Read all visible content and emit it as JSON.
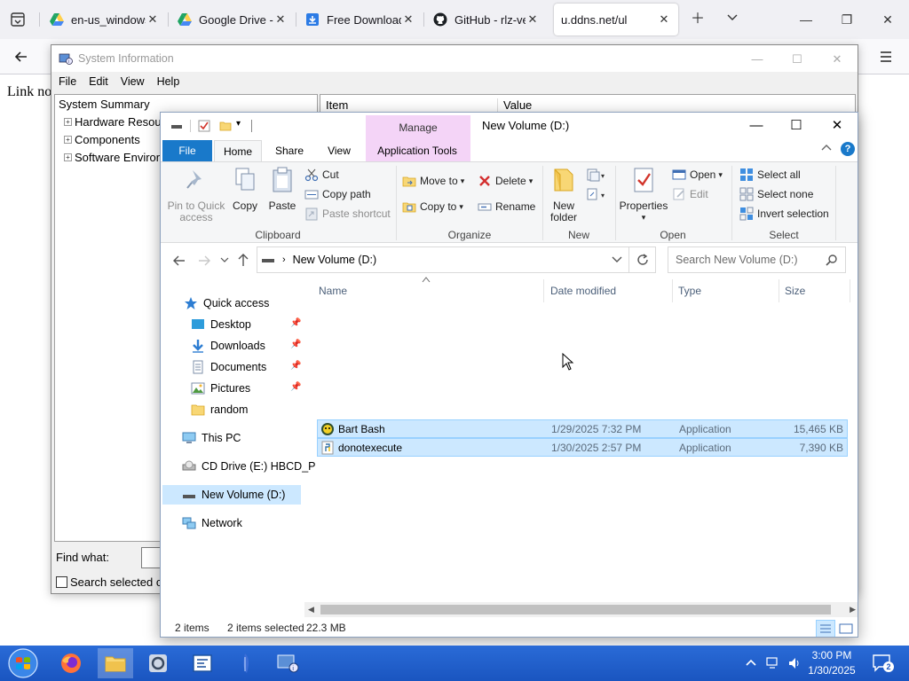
{
  "browser": {
    "tabs": [
      {
        "title": "en-us_windows",
        "icon": "google-drive-icon"
      },
      {
        "title": "Google Drive - V",
        "icon": "google-drive-icon"
      },
      {
        "title": "Free Download M",
        "icon": "download-icon"
      },
      {
        "title": "GitHub - rlz-ve/x",
        "icon": "github-icon"
      },
      {
        "title": "u.ddns.net/ul",
        "icon": ""
      }
    ],
    "page_text": "Link no"
  },
  "sysinfo": {
    "title": "System Information",
    "menu": [
      "File",
      "Edit",
      "View",
      "Help"
    ],
    "tree": [
      "System Summary",
      "Hardware Resou",
      "Components",
      "Software Enviror"
    ],
    "columns": [
      "Item",
      "Value"
    ],
    "find_label": "Find what:",
    "search_selected": "Search selected c"
  },
  "explorer": {
    "title": "New Volume (D:)",
    "manage_label": "Manage",
    "ribbon_tabs": [
      "File",
      "Home",
      "Share",
      "View",
      "Application Tools"
    ],
    "clipboard": {
      "label": "Clipboard",
      "pin": "Pin to Quick access",
      "copy": "Copy",
      "paste": "Paste",
      "cut": "Cut",
      "copy_path": "Copy path",
      "paste_shortcut": "Paste shortcut"
    },
    "organize": {
      "label": "Organize",
      "move_to": "Move to",
      "copy_to": "Copy to",
      "delete": "Delete",
      "rename": "Rename"
    },
    "new": {
      "label": "New",
      "new_folder": "New folder"
    },
    "open": {
      "label": "Open",
      "properties": "Properties",
      "open": "Open",
      "edit": "Edit"
    },
    "select": {
      "label": "Select",
      "select_all": "Select all",
      "select_none": "Select none",
      "invert": "Invert selection"
    },
    "address": "New Volume (D:)",
    "search_placeholder": "Search New Volume (D:)",
    "nav": {
      "quick_access": "Quick access",
      "desktop": "Desktop",
      "downloads": "Downloads",
      "documents": "Documents",
      "pictures": "Pictures",
      "random": "random",
      "this_pc": "This PC",
      "cd_drive": "CD Drive (E:) HBCD_P",
      "new_volume": "New Volume (D:)",
      "network": "Network"
    },
    "columns": [
      "Name",
      "Date modified",
      "Type",
      "Size"
    ],
    "files": [
      {
        "name": "Bart Bash",
        "date": "1/29/2025 7:32 PM",
        "type": "Application",
        "size": "15,465 KB"
      },
      {
        "name": "donotexecute",
        "date": "1/30/2025 2:57 PM",
        "type": "Application",
        "size": "7,390 KB"
      }
    ],
    "status": {
      "items": "2 items",
      "selected": "2 items selected",
      "size": "22.3 MB"
    }
  },
  "taskbar": {
    "time": "3:00 PM",
    "date": "1/30/2025",
    "notifications": "2"
  }
}
